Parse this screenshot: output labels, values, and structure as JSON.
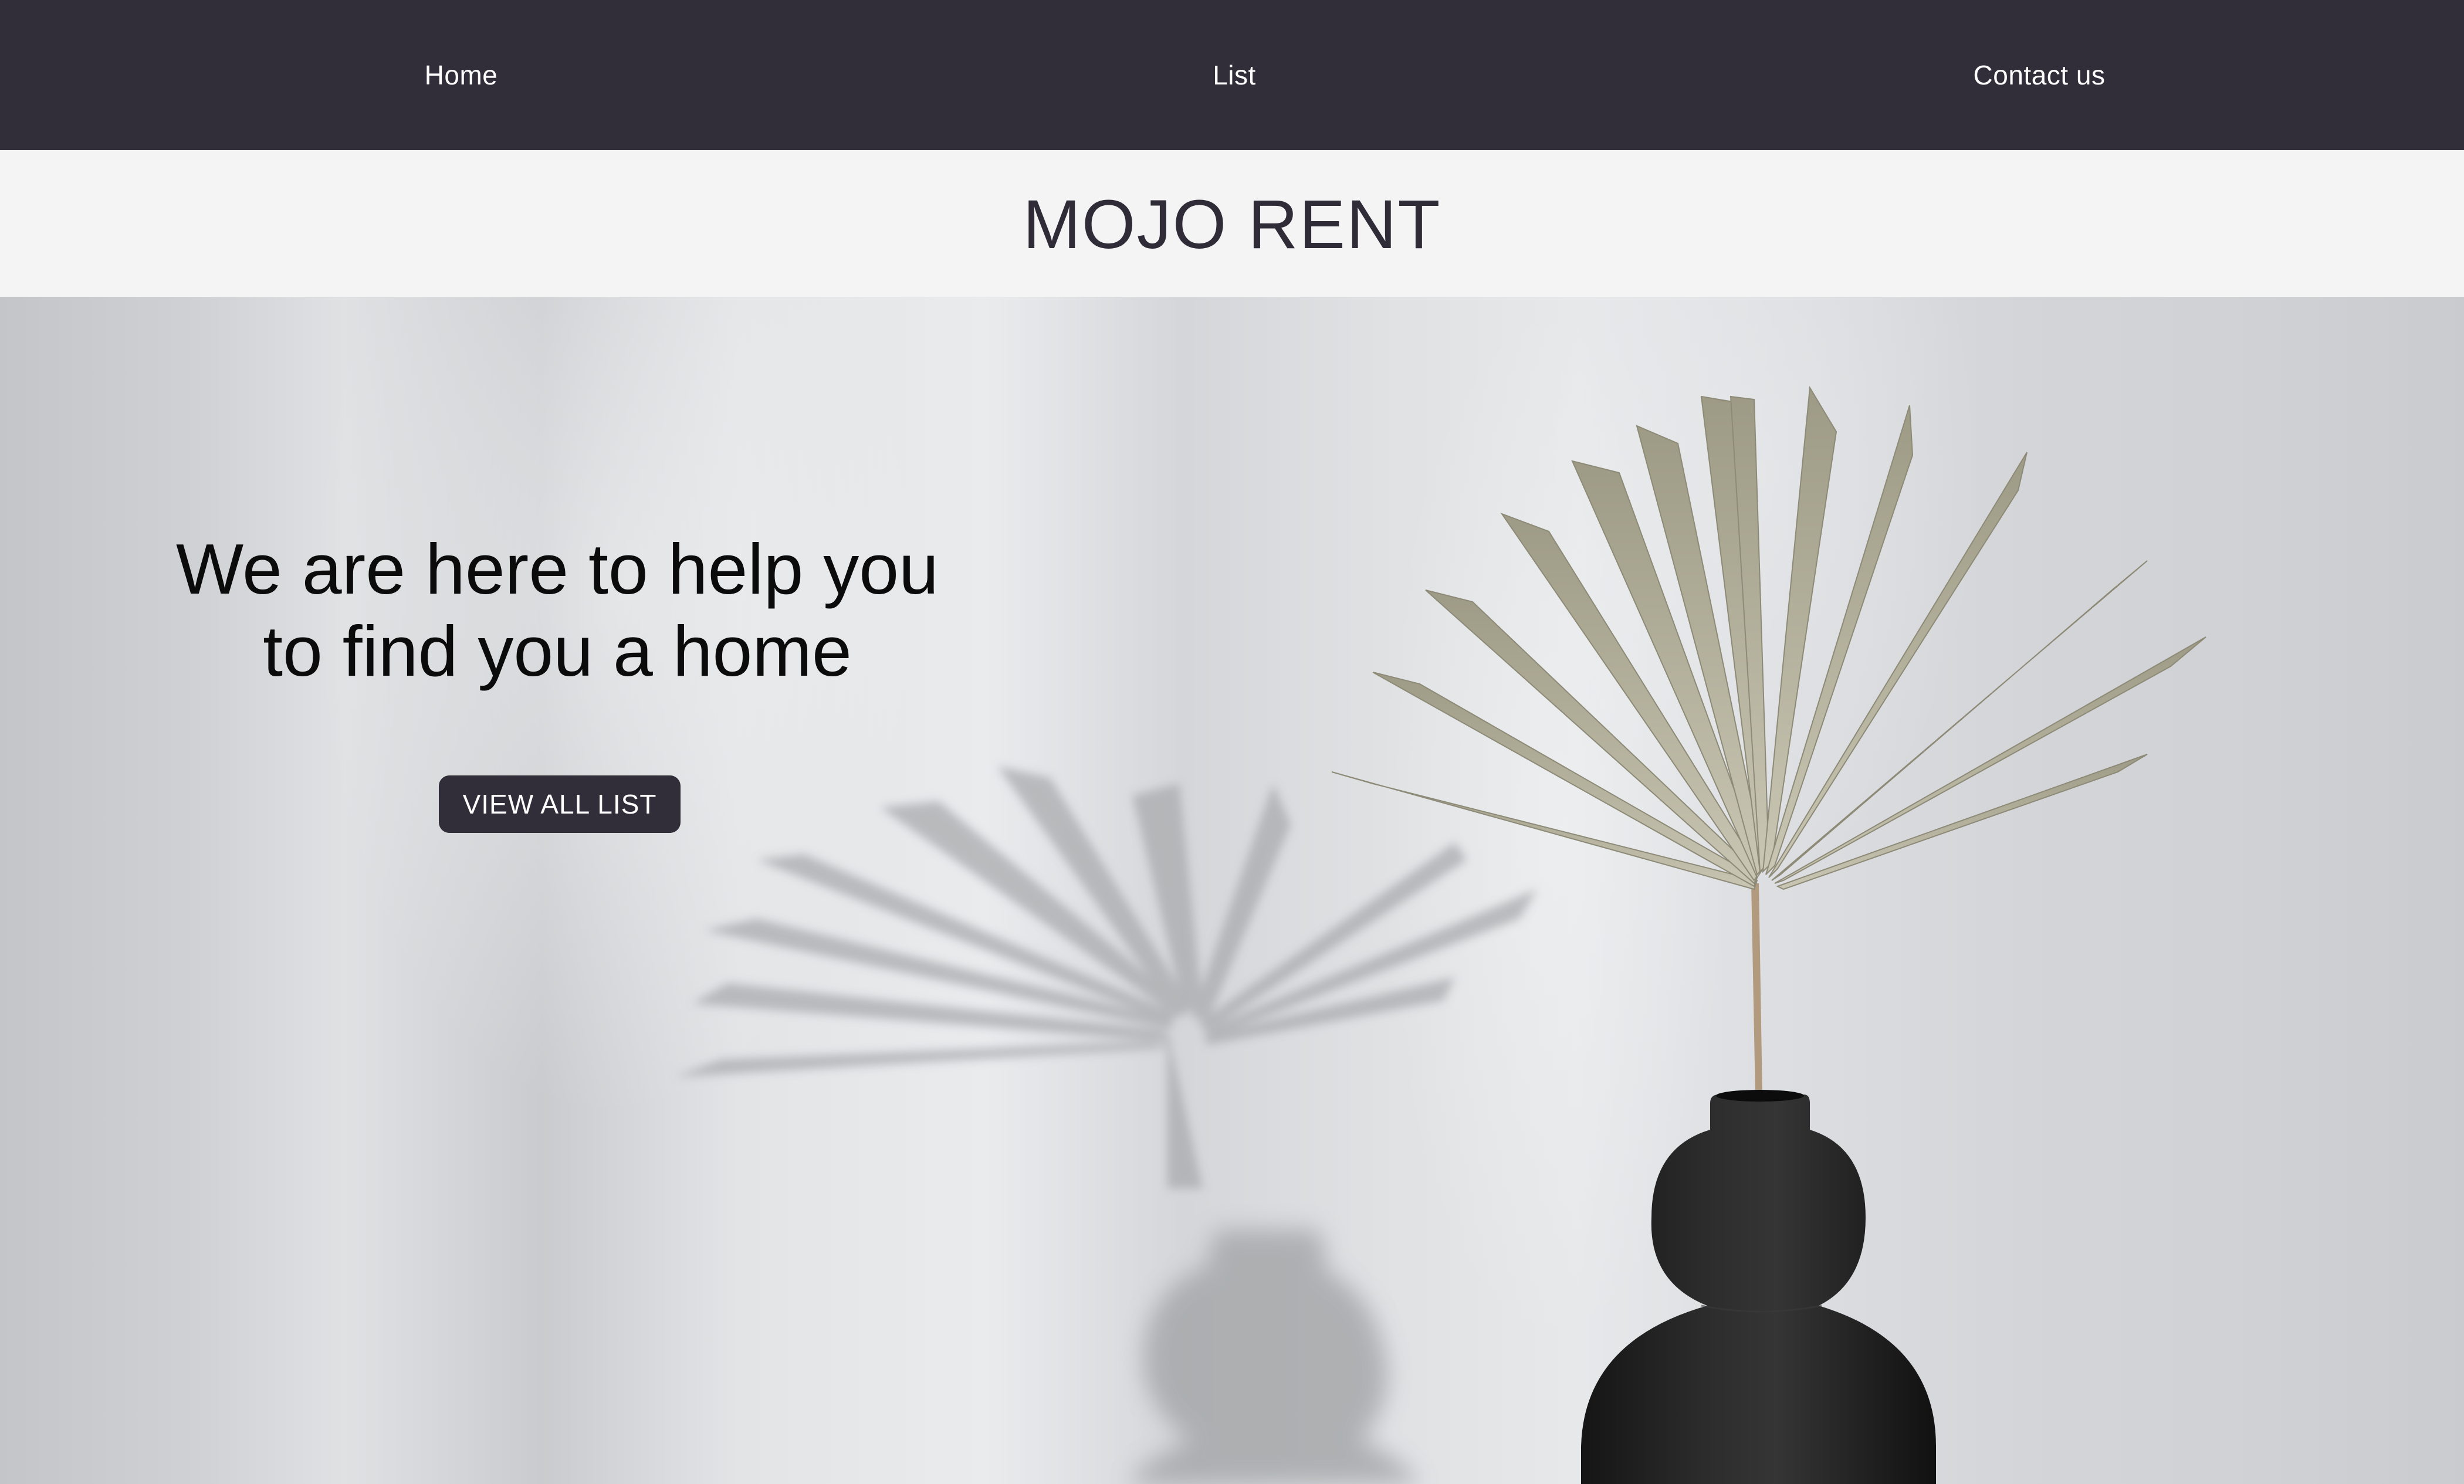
{
  "nav": {
    "items": [
      {
        "label": "Home"
      },
      {
        "label": "List"
      },
      {
        "label": "Contact us"
      }
    ],
    "background": "#312e3a"
  },
  "brand": {
    "title": "MOJO RENT"
  },
  "hero": {
    "heading_line1": "We are here to help you",
    "heading_line2": "to find you a home",
    "cta_label": "VIEW ALL LIST",
    "image": "photo of a dried palm leaf in a black ceramic vase against a light grey wall with shadows"
  },
  "colors": {
    "nav_bg": "#312e3a",
    "brand_band_bg": "#f4f4f4",
    "text_dark": "#2f2c38",
    "button_bg": "#312e3a",
    "button_text": "#ffffff"
  }
}
